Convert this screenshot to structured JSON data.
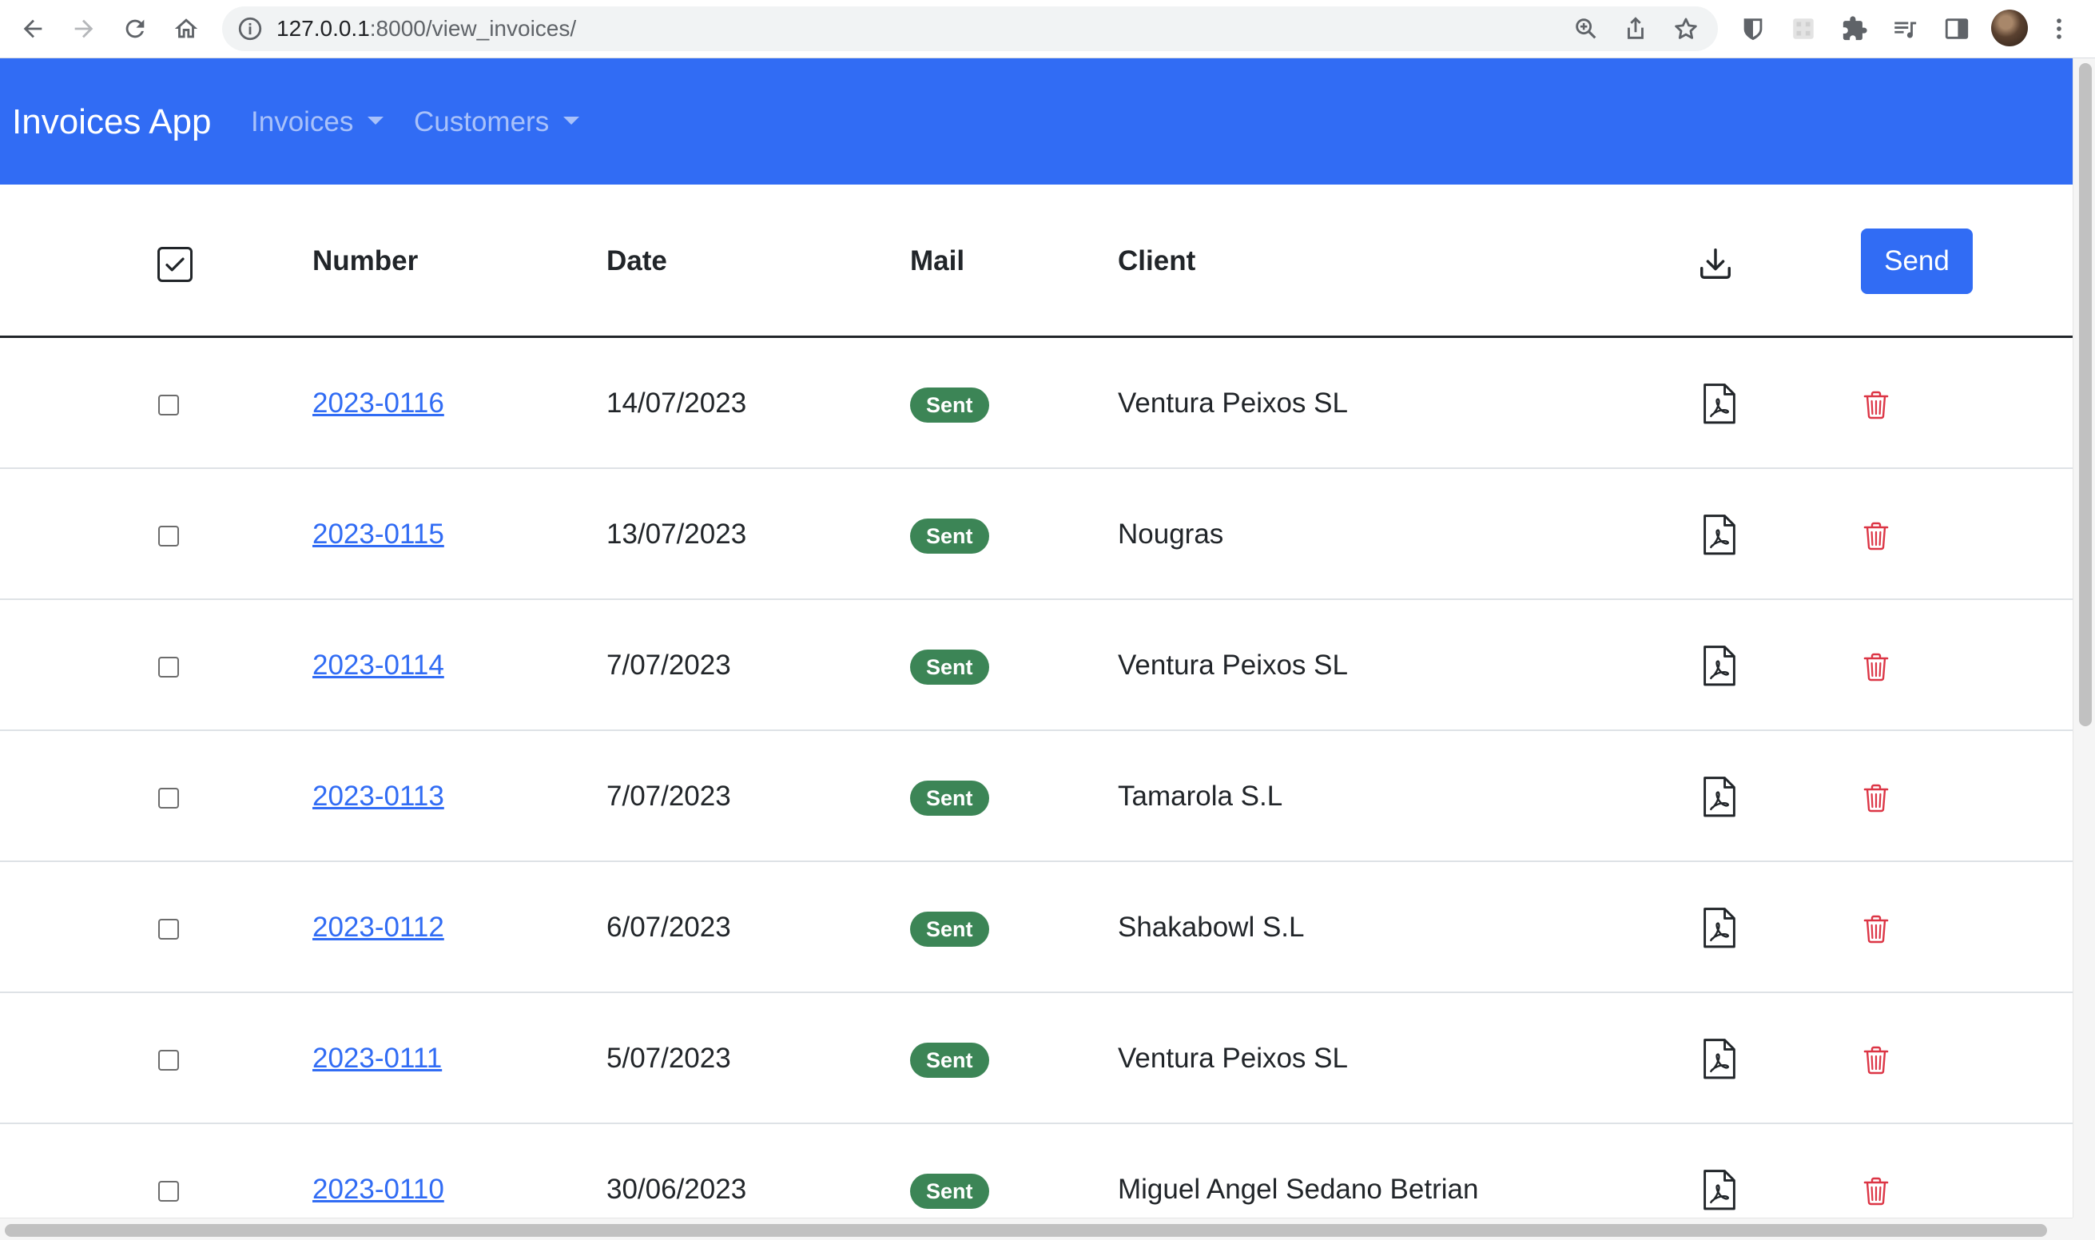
{
  "browser": {
    "url_host": "127.0.0.1",
    "url_rest": ":8000/view_invoices/",
    "icons": [
      "back-icon",
      "forward-icon",
      "reload-icon",
      "home-icon",
      "site-info-icon",
      "zoom-icon",
      "share-icon",
      "bookmark-star-icon",
      "bitwarden-icon",
      "extension-icon",
      "puzzle-extensions-icon",
      "media-control-icon",
      "side-panel-icon",
      "profile-avatar",
      "kebab-menu-icon"
    ]
  },
  "navbar": {
    "brand": "Invoices App",
    "menus": [
      {
        "label": "Invoices"
      },
      {
        "label": "Customers"
      }
    ],
    "background": "#316cf4"
  },
  "table": {
    "headers": {
      "number": "Number",
      "date": "Date",
      "mail": "Mail",
      "client": "Client"
    },
    "select_all_checked": true,
    "send_label": "Send",
    "rows": [
      {
        "number": "2023-0116",
        "date": "14/07/2023",
        "mail": "Sent",
        "client": "Ventura Peixos SL"
      },
      {
        "number": "2023-0115",
        "date": "13/07/2023",
        "mail": "Sent",
        "client": "Nougras"
      },
      {
        "number": "2023-0114",
        "date": "7/07/2023",
        "mail": "Sent",
        "client": "Ventura Peixos SL"
      },
      {
        "number": "2023-0113",
        "date": "7/07/2023",
        "mail": "Sent",
        "client": "Tamarola S.L"
      },
      {
        "number": "2023-0112",
        "date": "6/07/2023",
        "mail": "Sent",
        "client": "Shakabowl S.L"
      },
      {
        "number": "2023-0111",
        "date": "5/07/2023",
        "mail": "Sent",
        "client": "Ventura Peixos SL"
      },
      {
        "number": "2023-0110",
        "date": "30/06/2023",
        "mail": "Sent",
        "client": "Miguel Angel Sedano Betrian"
      }
    ]
  },
  "colors": {
    "primary": "#316cf4",
    "success": "#3c8556",
    "danger": "#dc3545"
  }
}
